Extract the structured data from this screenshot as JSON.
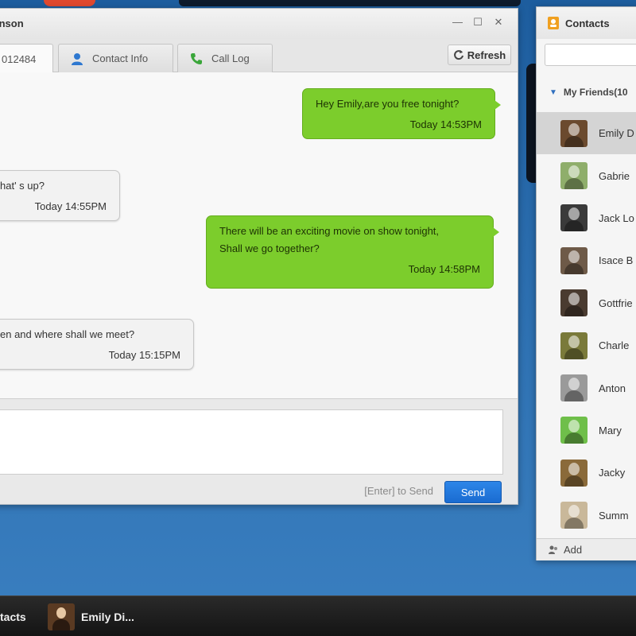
{
  "chat_window": {
    "title": "inson",
    "controls": [
      "—",
      "☐",
      "✕"
    ],
    "tabs": [
      {
        "label": "012484",
        "icon": "none"
      },
      {
        "label": "Contact Info",
        "icon": "person-icon"
      },
      {
        "label": "Call Log",
        "icon": "phone-icon"
      }
    ],
    "refresh_label": "Refresh",
    "messages": [
      {
        "direction": "out",
        "text": "Hey Emily,are you free tonight?",
        "time": "Today 14:53PM"
      },
      {
        "direction": "in",
        "text": "hat' s up?",
        "time": "Today  14:55PM"
      },
      {
        "direction": "out",
        "text": "There will be an exciting movie on show tonight,",
        "text2": "Shall we go together?",
        "time": "Today 14:58PM"
      },
      {
        "direction": "in",
        "text": "en and where shall we meet?",
        "time": "Today  15:15PM"
      }
    ],
    "send_hint": "[Enter] to Send",
    "send_label": "Send"
  },
  "contacts": {
    "title": "Contacts",
    "group_label": "My Friends(10",
    "items": [
      {
        "name": "Emily D",
        "color": "#6b4a2e",
        "selected": true
      },
      {
        "name": "Gabrie",
        "color": "#8fae6b"
      },
      {
        "name": "Jack Lo",
        "color": "#3a3a3a"
      },
      {
        "name": "Isace B",
        "color": "#6e5a48"
      },
      {
        "name": "Gottfrie",
        "color": "#4a3b30"
      },
      {
        "name": "Charle",
        "color": "#7a7a3a"
      },
      {
        "name": "Anton",
        "color": "#9a9a9a"
      },
      {
        "name": "Mary",
        "color": "#6fbf4a"
      },
      {
        "name": "Jacky",
        "color": "#8a6a3a"
      },
      {
        "name": "Summ",
        "color": "#c9b89a"
      }
    ],
    "footer_label": "Add"
  },
  "taskbar": {
    "items": [
      {
        "label": "tacts"
      },
      {
        "label": "Emily Di..."
      }
    ]
  },
  "colors": {
    "outgoing_bubble": "#7ccd2c",
    "send_button": "#1a6cd1",
    "desktop": "#2f72b3"
  }
}
